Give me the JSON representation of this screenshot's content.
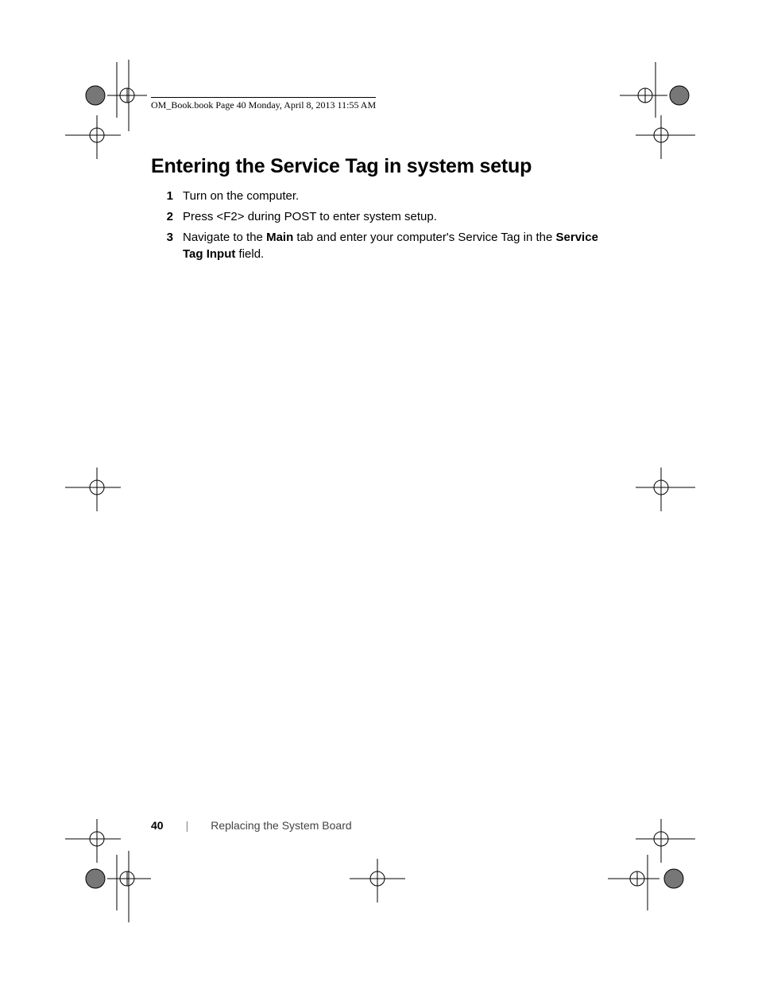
{
  "header": {
    "text": "OM_Book.book  Page 40  Monday, April 8, 2013  11:55 AM"
  },
  "section": {
    "heading": "Entering the Service Tag in system setup",
    "steps": [
      {
        "n": "1",
        "text": "Turn on the computer."
      },
      {
        "n": "2",
        "text": "Press <F2> during POST to enter system setup."
      },
      {
        "n": "3",
        "before": "Navigate to the ",
        "bold1": "Main",
        "mid": " tab and enter your computer's Service Tag in the ",
        "bold2": "Service Tag Input",
        "after": " field."
      }
    ]
  },
  "footer": {
    "page_number": "40",
    "separator": "|",
    "chapter": "Replacing the System Board"
  }
}
